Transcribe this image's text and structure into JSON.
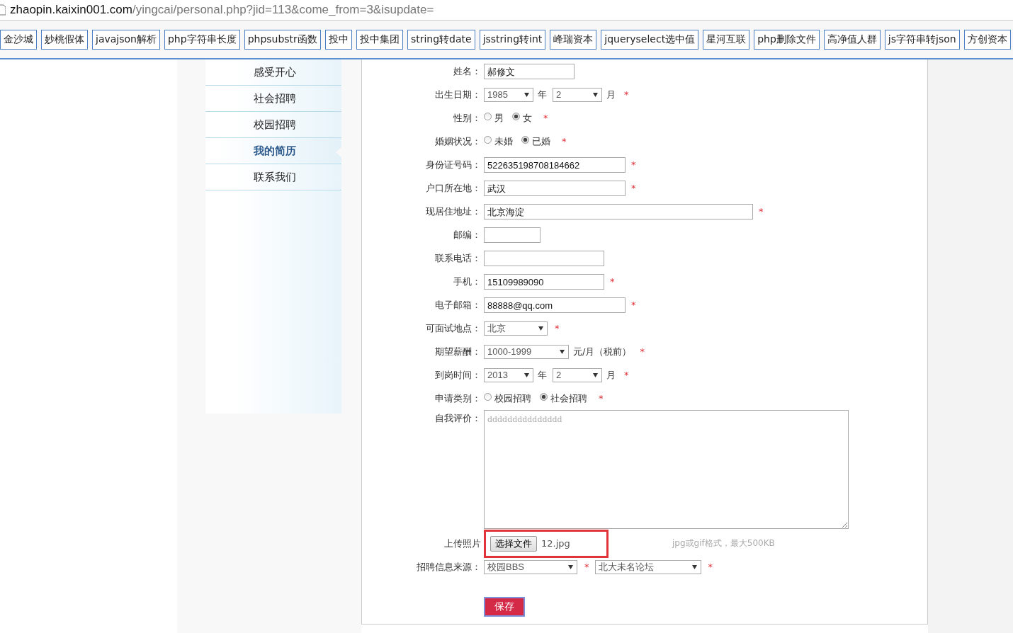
{
  "browser": {
    "url_host": "zhaopin.kaixin001.com",
    "url_path": "/yingcai/personal.php?jid=113&come_from=3&isupdate=",
    "bookmarks": [
      "金沙城",
      "妙桃假体",
      "javajson解析",
      "php字符串长度",
      "phpsubstr函数",
      "投中",
      "投中集团",
      "string转date",
      "jsstring转int",
      "峰瑞资本",
      "jqueryselect选中值",
      "星河互联",
      "php删除文件",
      "高净值人群",
      "js字符串转json",
      "方创资本"
    ]
  },
  "sidebar": {
    "items": [
      {
        "label": "感受开心",
        "selected": false
      },
      {
        "label": "社会招聘",
        "selected": false
      },
      {
        "label": "校园招聘",
        "selected": false
      },
      {
        "label": "我的简历",
        "selected": true
      },
      {
        "label": "联系我们",
        "selected": false
      }
    ]
  },
  "form": {
    "rows": [
      {
        "label": "姓名：",
        "controls": [
          {
            "kind": "text",
            "value": "郝修文"
          }
        ]
      },
      {
        "label": "出生日期：",
        "controls": [
          {
            "kind": "select",
            "value": "1985"
          },
          {
            "kind": "unit",
            "text": "年"
          },
          {
            "kind": "select",
            "value": "2"
          },
          {
            "kind": "unit",
            "text": "月"
          },
          {
            "kind": "mark",
            "text": "*"
          }
        ]
      },
      {
        "label": "性别：",
        "controls": [
          {
            "kind": "radio",
            "label": "男",
            "selected": false
          },
          {
            "kind": "radio",
            "label": "女",
            "selected": true
          },
          {
            "kind": "mark",
            "text": "*"
          }
        ]
      },
      {
        "label": "婚姻状况：",
        "controls": [
          {
            "kind": "radio",
            "label": "未婚",
            "selected": false
          },
          {
            "kind": "radio",
            "label": "已婚",
            "selected": true
          },
          {
            "kind": "mark",
            "text": "*"
          }
        ]
      },
      {
        "label": "身份证号码：",
        "controls": [
          {
            "kind": "text",
            "value": "522635198708184662"
          },
          {
            "kind": "mark",
            "text": "*"
          }
        ]
      },
      {
        "label": "户口所在地：",
        "controls": [
          {
            "kind": "text",
            "value": "武汉"
          },
          {
            "kind": "mark",
            "text": "*"
          }
        ]
      },
      {
        "label": "现居住地址：",
        "controls": [
          {
            "kind": "text",
            "value": "北京海淀"
          },
          {
            "kind": "mark",
            "text": "*"
          }
        ]
      },
      {
        "label": "邮编：",
        "controls": [
          {
            "kind": "text"
          }
        ]
      },
      {
        "label": "联系电话：",
        "controls": [
          {
            "kind": "text"
          }
        ]
      },
      {
        "label": "手机：",
        "controls": [
          {
            "kind": "text",
            "value": "15109989090"
          },
          {
            "kind": "mark",
            "text": "*"
          }
        ]
      },
      {
        "label": "电子邮箱：",
        "controls": [
          {
            "kind": "text",
            "value": "88888@qq.com"
          },
          {
            "kind": "mark",
            "text": "*"
          }
        ]
      },
      {
        "label": "可面试地点：",
        "controls": [
          {
            "kind": "select",
            "value": "北京"
          },
          {
            "kind": "mark",
            "text": "*"
          }
        ]
      },
      {
        "label": "期望薪酬：",
        "controls": [
          {
            "kind": "select",
            "value": "1000-1999"
          },
          {
            "kind": "unit",
            "text": "元/月（税前）"
          },
          {
            "kind": "mark",
            "text": "*"
          }
        ]
      },
      {
        "label": "到岗时间：",
        "controls": [
          {
            "kind": "select",
            "value": "2013"
          },
          {
            "kind": "unit",
            "text": "年"
          },
          {
            "kind": "select",
            "value": "2"
          },
          {
            "kind": "unit",
            "text": "月"
          },
          {
            "kind": "mark",
            "text": "*"
          }
        ]
      },
      {
        "label": "申请类别：",
        "controls": [
          {
            "kind": "radio",
            "label": "校园招聘",
            "selected": false
          },
          {
            "kind": "radio",
            "label": "社会招聘",
            "selected": true
          },
          {
            "kind": "mark",
            "text": "*"
          }
        ]
      },
      {
        "label": "自我评价：",
        "controls": [
          {
            "kind": "textarea",
            "placeholder": "ddddddddddddddd"
          }
        ]
      },
      {
        "label": "上传照片",
        "controls": [
          {
            "kind": "file",
            "button": "选择文件",
            "value": "12.jpg",
            "highlighted": true
          },
          {
            "kind": "hint",
            "text": "jpg或gif格式，最大500KB"
          }
        ]
      },
      {
        "label": "招聘信息来源：",
        "controls": [
          {
            "kind": "select",
            "value": "校园BBS"
          },
          {
            "kind": "mark",
            "text": "*"
          },
          {
            "kind": "select",
            "value": "北大未名论坛"
          },
          {
            "kind": "mark",
            "text": "*"
          }
        ]
      }
    ],
    "submit": "保存"
  }
}
